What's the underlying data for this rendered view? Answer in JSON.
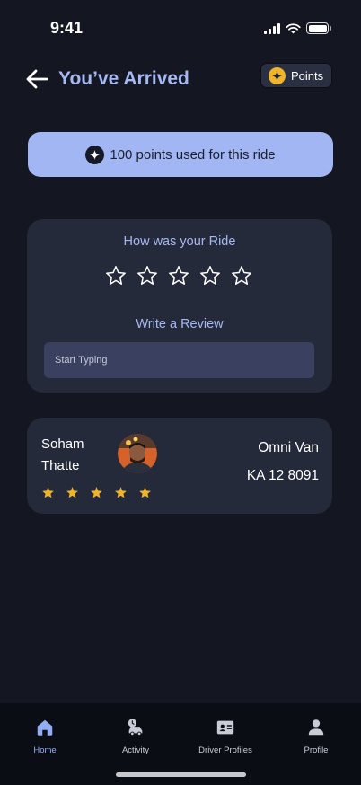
{
  "status_bar": {
    "time": "9:41"
  },
  "header": {
    "title": "You’ve Arrived",
    "back_icon": "arrow-left-icon",
    "points_label": "Points",
    "points_icon": "sparkle-coin-icon"
  },
  "banner": {
    "text": "100 points used for this ride",
    "icon": "sparkle-icon"
  },
  "rating": {
    "title": "How was your Ride",
    "max_stars": 5,
    "selected": 0,
    "review_title": "Write a Review",
    "review_placeholder": "Start Typing"
  },
  "driver": {
    "first_name": "Soham",
    "last_name": "Thatte",
    "rating": 5,
    "vehicle_model": "Omni Van",
    "plate": "KA 12 8091"
  },
  "nav": {
    "items": [
      {
        "label": "Home",
        "icon": "home-icon",
        "active": true
      },
      {
        "label": "Activity",
        "icon": "activity-icon",
        "active": false
      },
      {
        "label": "Driver Profiles",
        "icon": "id-card-icon",
        "active": false
      },
      {
        "label": "Profile",
        "icon": "person-icon",
        "active": false
      }
    ]
  },
  "colors": {
    "background": "#141722",
    "card": "#252a3b",
    "accent": "#a5b8f2",
    "banner": "#a1b6f3",
    "star_gold": "#f0b429",
    "nav_active": "#93adf2"
  }
}
